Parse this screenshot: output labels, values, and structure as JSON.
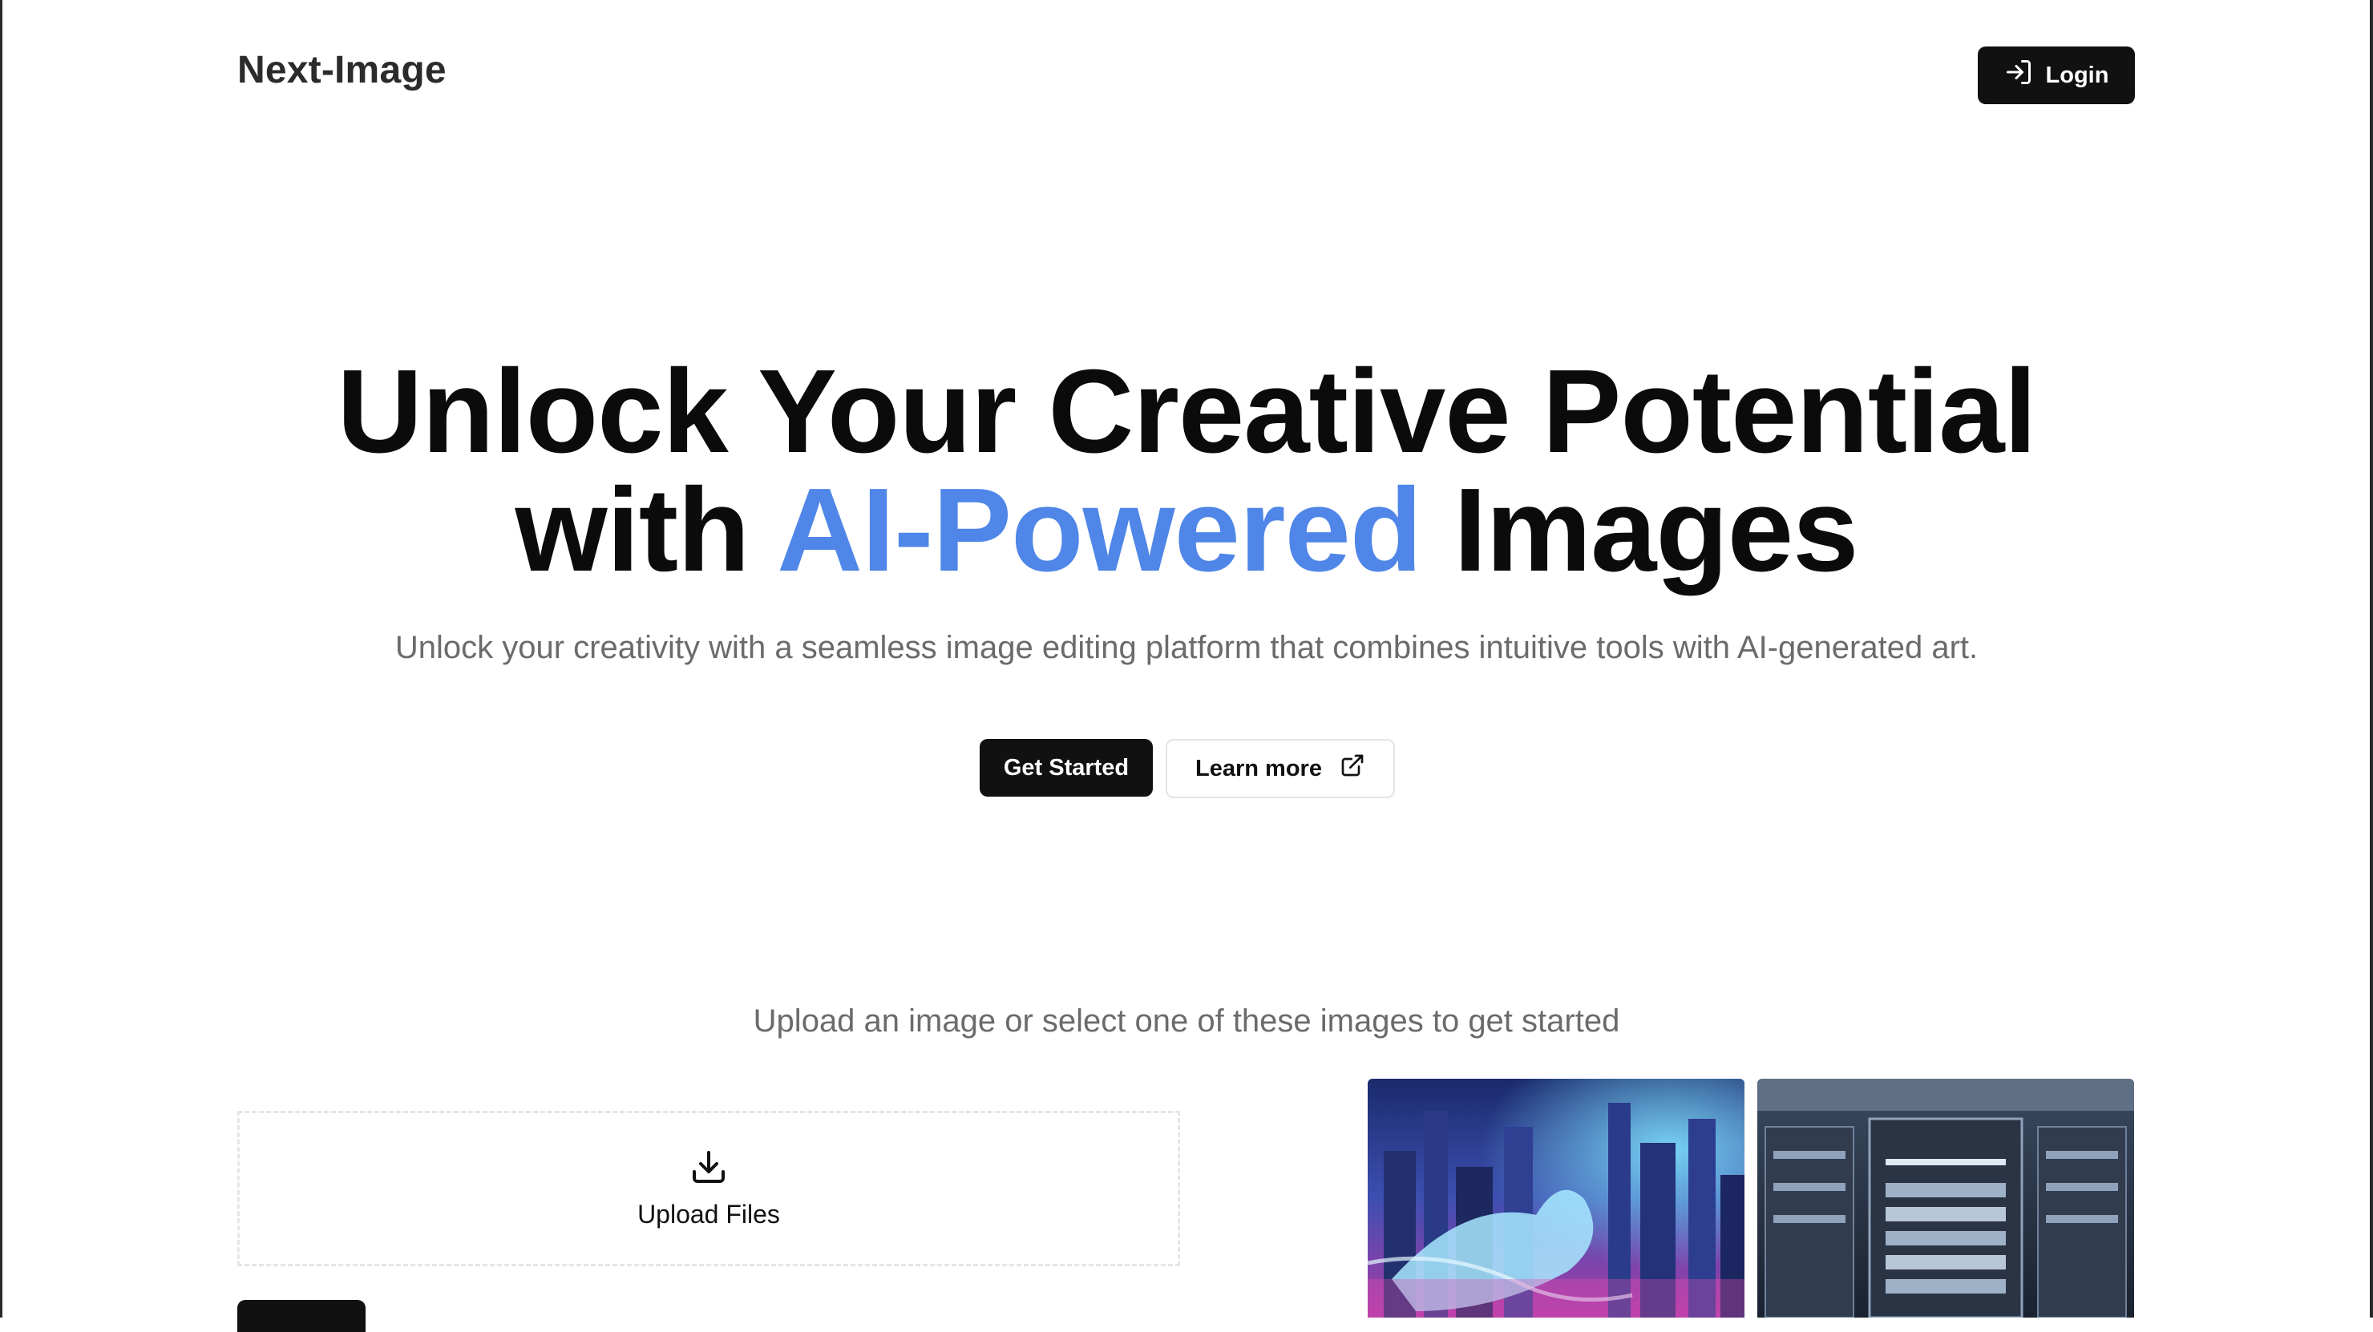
{
  "header": {
    "brand": "Next-Image",
    "login_label": "Login"
  },
  "hero": {
    "title_line1": "Unlock Your Creative Potential",
    "title_line2_pre": "with ",
    "title_line2_accent": "AI-Powered",
    "title_line2_post": " Images",
    "subtitle": "Unlock your creativity with a seamless image editing platform that combines intuitive tools with AI-generated art.",
    "primary_cta": "Get Started",
    "secondary_cta": "Learn more"
  },
  "upload": {
    "caption": "Upload an image or select one of these images to get started",
    "dropzone_label": "Upload Files"
  },
  "samples": [
    {
      "icon": "neon-cat-city-image"
    },
    {
      "icon": "server-rack-image"
    }
  ],
  "colors": {
    "accent": "#4f86e8",
    "primary_button": "#111111",
    "muted_text": "#6b6b6b"
  }
}
